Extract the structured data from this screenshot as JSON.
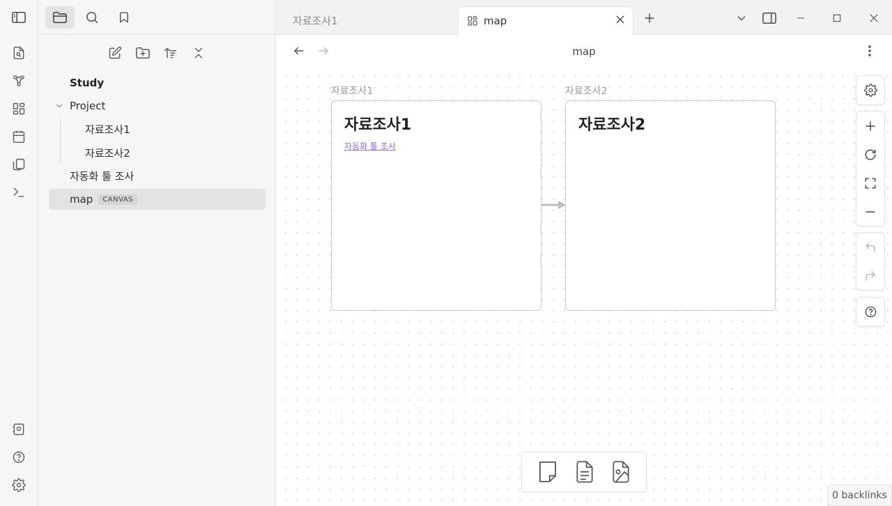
{
  "sidebar": {
    "vault_name": "Study",
    "items": [
      {
        "label": "Project"
      },
      {
        "label": "자료조사1"
      },
      {
        "label": "자료조사2"
      },
      {
        "label": "자동화 툴 조사"
      },
      {
        "label": "map",
        "tag": "CANVAS"
      }
    ]
  },
  "tabs": [
    {
      "label": "자료조사1",
      "active": false
    },
    {
      "label": "map",
      "active": true
    }
  ],
  "view": {
    "title": "map"
  },
  "canvas": {
    "nodes": [
      {
        "label": "자료조사1",
        "heading": "자료조사1",
        "link": "자동화 툴 조사"
      },
      {
        "label": "자료조사2",
        "heading": "자료조사2"
      }
    ]
  },
  "status": {
    "backlinks": "0 backlinks"
  },
  "colors": {
    "accent_link": "#8a6cf0",
    "selected_item": "#e3e3e3"
  }
}
